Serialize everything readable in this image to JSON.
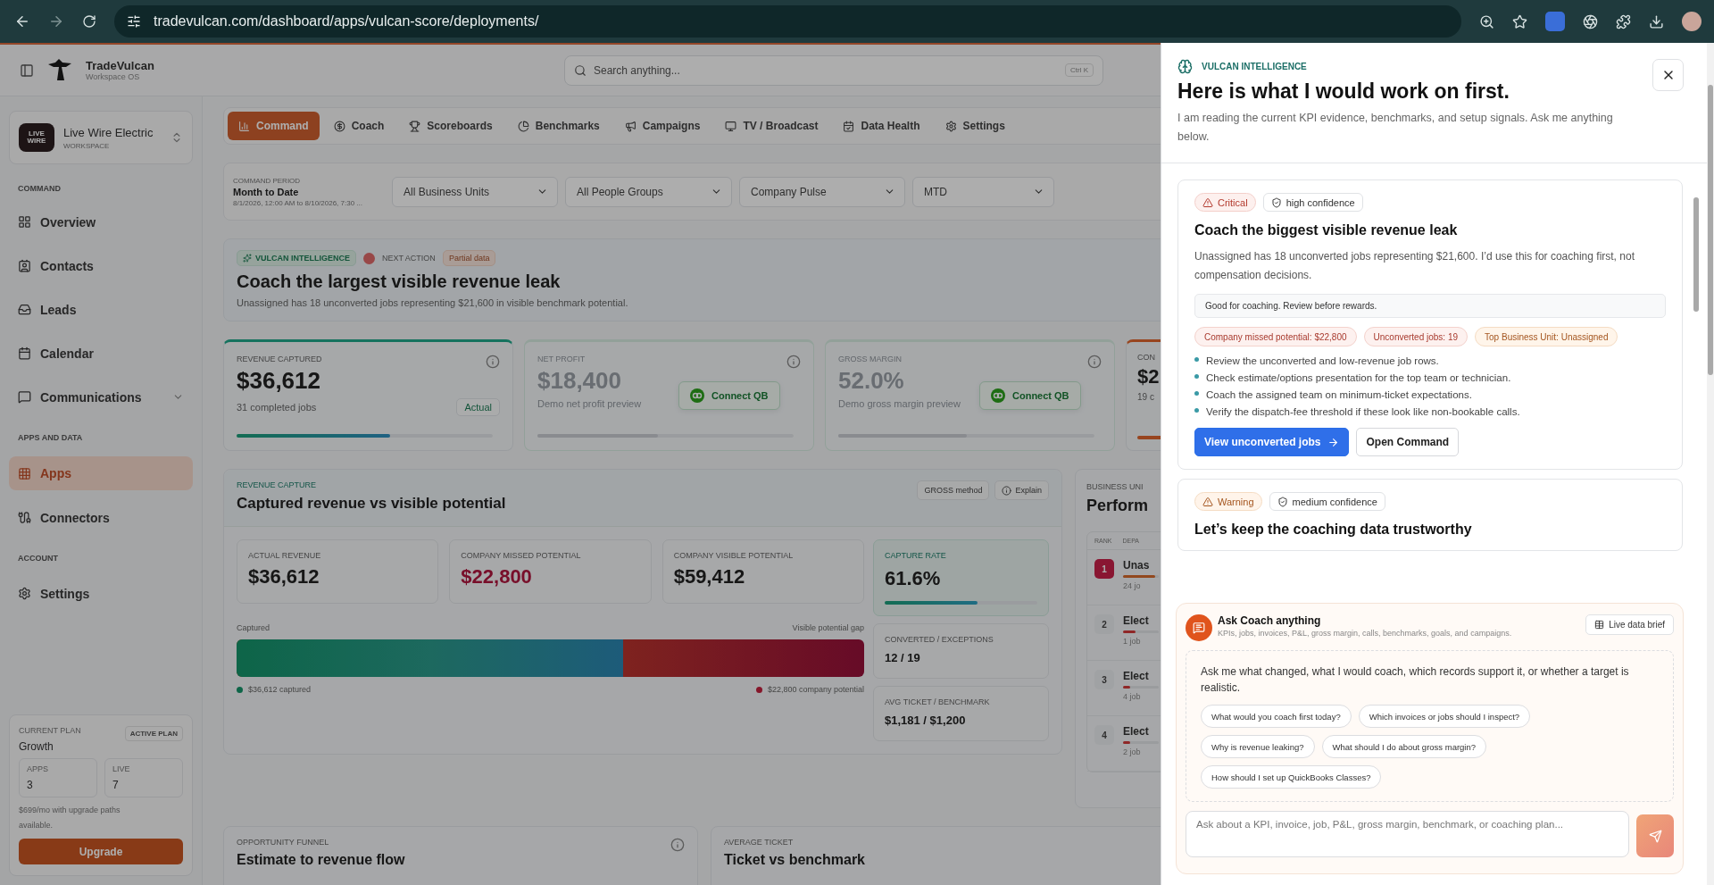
{
  "browser": {
    "url": "tradevulcan.com/dashboard/apps/vulcan-score/deployments/"
  },
  "app_header": {
    "brand": "TradeVulcan",
    "brand_sub": "Workspace OS",
    "search": {
      "placeholder": "Search anything...",
      "shortcut": "Ctrl K"
    }
  },
  "sidebar": {
    "workspace": {
      "logo_text": "LIVE WIRE",
      "name": "Live Wire Electric",
      "type": "WORKSPACE"
    },
    "sections": [
      {
        "heading": "COMMAND",
        "items": [
          {
            "label": "Overview",
            "selected": false
          },
          {
            "label": "Contacts",
            "selected": false
          },
          {
            "label": "Leads",
            "selected": false
          },
          {
            "label": "Calendar",
            "selected": false
          },
          {
            "label": "Communications",
            "selected": false,
            "expanded": false
          }
        ]
      },
      {
        "heading": "APPS AND DATA",
        "items": [
          {
            "label": "Apps",
            "selected": true
          },
          {
            "label": "Connectors",
            "selected": false
          }
        ]
      },
      {
        "heading": "ACCOUNT",
        "items": [
          {
            "label": "Settings",
            "selected": false
          }
        ]
      }
    ],
    "plan": {
      "label": "CURRENT PLAN",
      "name": "Growth",
      "badge": "ACTIVE PLAN",
      "stats": [
        {
          "label": "APPS",
          "value": "3"
        },
        {
          "label": "LIVE",
          "value": "7"
        }
      ],
      "note": "$699/mo with upgrade paths available.",
      "button": "Upgrade"
    }
  },
  "main": {
    "tabs": [
      {
        "label": "Command",
        "selected": true
      },
      {
        "label": "Coach",
        "selected": false
      },
      {
        "label": "Scoreboards",
        "selected": false
      },
      {
        "label": "Benchmarks",
        "selected": false
      },
      {
        "label": "Campaigns",
        "selected": false
      },
      {
        "label": "TV / Broadcast",
        "selected": false
      },
      {
        "label": "Data Health",
        "selected": false
      },
      {
        "label": "Settings",
        "selected": false
      }
    ],
    "filters": {
      "period_label": "COMMAND PERIOD",
      "period": "Month to Date",
      "range": "8/1/2026, 12:00 AM to 8/10/2026, 7:30 ...",
      "selects": [
        "All Business Units",
        "All People Groups",
        "Company Pulse",
        "MTD"
      ]
    },
    "insight": {
      "tag": "VULCAN INTELLIGENCE",
      "next": "NEXT ACTION",
      "badge": "Partial data",
      "title": "Coach the largest visible revenue leak",
      "text": "Unassigned has 18 unconverted jobs representing $21,600 in visible benchmark potential."
    },
    "kpis": [
      {
        "label": "REVENUE CAPTURED",
        "value": "$36,612",
        "sub": "31 completed jobs",
        "badge": "Actual",
        "level": 0.6,
        "locked": false
      },
      {
        "label": "NET PROFIT",
        "value": "$18,400",
        "sub": "Demo net profit preview",
        "connect": "Connect QB",
        "level": 0.47,
        "locked": true
      },
      {
        "label": "GROSS MARGIN",
        "value": "52.0%",
        "sub": "Demo gross margin preview",
        "connect": "Connect QB",
        "level": 0.5,
        "locked": true
      },
      {
        "label": "CON",
        "value": "$2",
        "sub": "19 c",
        "level": 0.9,
        "locked": false
      }
    ],
    "revenue": {
      "eyebrow": "REVENUE CAPTURE",
      "title": "Captured revenue vs visible potential",
      "method": "GROSS method",
      "explain": "Explain",
      "stats": [
        {
          "label": "ACTUAL REVENUE",
          "value": "$36,612",
          "kind": "normal"
        },
        {
          "label": "COMPANY MISSED POTENTIAL",
          "value": "$22,800",
          "kind": "negative"
        },
        {
          "label": "COMPANY VISIBLE POTENTIAL",
          "value": "$59,412",
          "kind": "normal"
        }
      ],
      "bar": {
        "left_label": "Captured",
        "right_label": "Visible potential gap",
        "level": 0.616,
        "left_legend": "$36,612 captured",
        "right_legend": "$22,800 company potential"
      },
      "side": [
        {
          "label": "CAPTURE RATE",
          "value": "61.6%",
          "level": 0.61
        },
        {
          "label": "CONVERTED / EXCEPTIONS",
          "value": "12 / 19"
        },
        {
          "label": "AVG TICKET / BENCHMARK",
          "value": "$1,181 / $1,200"
        }
      ]
    },
    "business": {
      "eyebrow": "BUSINESS UNI",
      "title": "Perform",
      "columns": [
        "RANK",
        "DEPA"
      ],
      "rows": [
        {
          "rank": "1",
          "name": "Unas",
          "sub": "24 jo",
          "level": 0.9,
          "highlight": true
        },
        {
          "rank": "2",
          "name": "Elect",
          "sub": "1 job",
          "level": 0.35,
          "highlight": false
        },
        {
          "rank": "3",
          "name": "Elect",
          "sub": "4 job",
          "level": 0.2,
          "highlight": false
        },
        {
          "rank": "4",
          "name": "Elect",
          "sub": "2 job",
          "level": 0.2,
          "highlight": false
        }
      ]
    },
    "bottom": [
      {
        "eyebrow": "OPPORTUNITY FUNNEL",
        "title": "Estimate to revenue flow",
        "info_button": true
      },
      {
        "eyebrow": "AVERAGE TICKET",
        "title": "Ticket vs benchmark"
      }
    ]
  },
  "drawer": {
    "eyebrow": "VULCAN INTELLIGENCE",
    "title": "Here is what I would work on first.",
    "text": "I am reading the current KPI evidence, benchmarks, and setup signals. Ask me anything below.",
    "cards": [
      {
        "kind": "critical",
        "severity": "Critical",
        "confidence": "high confidence",
        "title": "Coach the biggest visible revenue leak",
        "text": "Unassigned has 18 unconverted jobs representing $21,600. I’d use this for coaching first, not compensation decisions.",
        "note": "Good for coaching. Review before rewards.",
        "chips": [
          {
            "label": "Company missed potential: $22,800",
            "kind": "danger"
          },
          {
            "label": "Unconverted jobs: 19",
            "kind": "danger"
          },
          {
            "label": "Top Business Unit: Unassigned",
            "kind": "warning"
          }
        ],
        "steps": [
          "Review the unconverted and low-revenue job rows.",
          "Check estimate/options presentation for the top team or technician.",
          "Coach the assigned team on minimum-ticket expectations.",
          "Verify the dispatch-fee threshold if these look like non-bookable calls."
        ],
        "actions": [
          {
            "label": "View unconverted jobs",
            "kind": "primary"
          },
          {
            "label": "Open Command",
            "kind": "secondary"
          }
        ]
      },
      {
        "kind": "warning",
        "severity": "Warning",
        "confidence": "medium confidence",
        "title": "Let’s keep the coaching data trustworthy"
      }
    ]
  },
  "coach": {
    "title": "Ask Coach anything",
    "subtitle": "KPIs, jobs, invoices, P&L, gross margin, calls, benchmarks, goals, and campaigns.",
    "brief": "Live data brief",
    "prompt": "Ask me what changed, what I would coach, which records support it, or whether a target is realistic.",
    "suggestions": [
      "What would you coach first today?",
      "Which invoices or jobs should I inspect?",
      "Why is revenue leaking?",
      "What should I do about gross margin?",
      "How should I set up QuickBooks Classes?"
    ],
    "input": {
      "placeholder": "Ask about a KPI, invoice, job, P&L, gross margin, benchmark, or coaching plan..."
    }
  }
}
